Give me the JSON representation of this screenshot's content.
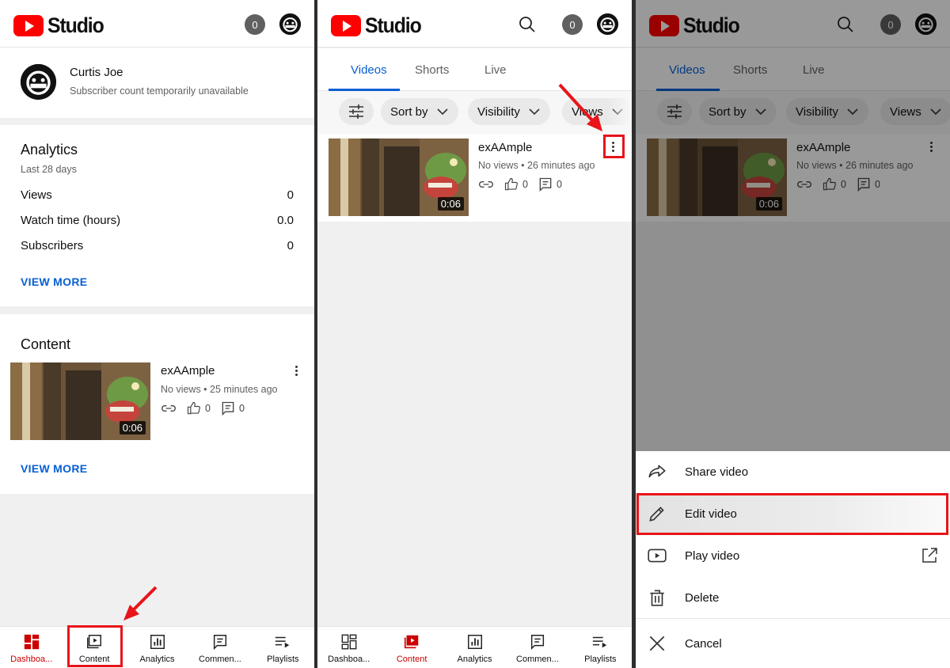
{
  "brand": {
    "logo_text": "Studio",
    "red": "#ff0000",
    "blue": "#065fd4",
    "annotation_red": "#e8141a"
  },
  "header": {
    "notification_count": "0"
  },
  "dashboard": {
    "channel": {
      "name": "Curtis Joe",
      "subscribers": "Subscriber count temporarily unavailable"
    },
    "analytics": {
      "title": "Analytics",
      "period": "Last 28 days",
      "stats": [
        {
          "label": "Views",
          "value": "0"
        },
        {
          "label": "Watch time (hours)",
          "value": "0.0"
        },
        {
          "label": "Subscribers",
          "value": "0"
        }
      ],
      "view_more": "VIEW MORE"
    },
    "content": {
      "title": "Content",
      "video": {
        "title": "exAAmple",
        "meta": "No views • 25 minutes ago",
        "duration": "0:06",
        "likes": "0",
        "comments": "0"
      },
      "view_more": "VIEW MORE"
    }
  },
  "content_page": {
    "tabs": [
      "Videos",
      "Shorts",
      "Live"
    ],
    "filters": [
      "Sort by",
      "Visibility",
      "Views"
    ],
    "video": {
      "title": "exAAmple",
      "meta": "No views • 26 minutes ago",
      "duration": "0:06",
      "likes": "0",
      "comments": "0"
    }
  },
  "menu": {
    "items": [
      "Share video",
      "Edit video",
      "Play video",
      "Delete"
    ],
    "cancel": "Cancel"
  },
  "bottom_nav": {
    "items": [
      "Dashboa...",
      "Content",
      "Analytics",
      "Commen...",
      "Playlists"
    ]
  }
}
